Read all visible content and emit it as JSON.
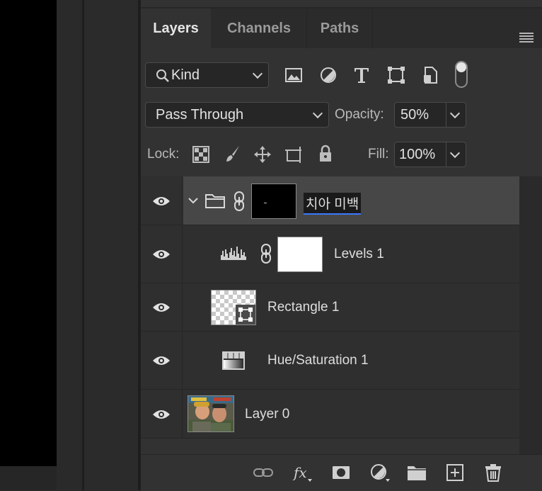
{
  "panel": {
    "tabs": [
      {
        "label": "Layers",
        "active": true
      },
      {
        "label": "Channels",
        "active": false
      },
      {
        "label": "Paths",
        "active": false
      }
    ],
    "menu_icon": "panel-menu-icon"
  },
  "filter": {
    "kind_label": "Kind",
    "filter_icons": [
      "image-filter-icon",
      "adjustment-filter-icon",
      "type-filter-icon",
      "shape-filter-icon",
      "smart-object-filter-icon",
      "filter-toggle-icon"
    ]
  },
  "blend": {
    "mode": "Pass Through",
    "opacity_label": "Opacity:",
    "opacity_value": "50%"
  },
  "lock": {
    "label": "Lock:",
    "icons": [
      "lock-transparent-icon",
      "lock-image-icon",
      "lock-position-icon",
      "lock-artboard-icon",
      "lock-all-icon"
    ],
    "fill_label": "Fill:",
    "fill_value": "100%"
  },
  "layers": [
    {
      "name": "치아 미백",
      "type": "group",
      "visible": true,
      "selected": true,
      "has_mask": true
    },
    {
      "name": "Levels 1",
      "type": "levels-adjustment",
      "visible": true,
      "has_mask": true
    },
    {
      "name": "Rectangle 1",
      "type": "shape",
      "visible": true
    },
    {
      "name": "Hue/Saturation 1",
      "type": "hue-saturation-adjustment",
      "visible": true
    },
    {
      "name": "Layer 0",
      "type": "image",
      "visible": true
    }
  ],
  "bottom_icons": [
    "link-layers-icon",
    "fx-icon",
    "add-mask-icon",
    "new-adjustment-icon",
    "new-group-icon",
    "new-layer-icon",
    "delete-layer-icon"
  ],
  "colors": {
    "panel_bg": "#323232",
    "selected_row": "#474747",
    "text": "#dedede"
  }
}
